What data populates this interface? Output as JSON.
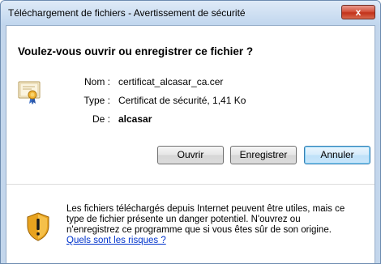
{
  "window": {
    "title": "Téléchargement de fichiers - Avertissement de sécurité",
    "close_label": "x"
  },
  "question": "Voulez-vous ouvrir ou enregistrer ce fichier ?",
  "file_info": {
    "name_label": "Nom :",
    "name_value": "certificat_alcasar_ca.cer",
    "type_label": "Type :",
    "type_value": "Certificat de sécurité, 1,41 Ko",
    "from_label": "De :",
    "from_value": "alcasar"
  },
  "buttons": {
    "open": "Ouvrir",
    "save": "Enregistrer",
    "cancel": "Annuler"
  },
  "warning": {
    "line1": "Les fichiers téléchargés depuis Internet peuvent être utiles, mais ce",
    "line2": "type de fichier présente un danger potentiel. N'ouvrez ou",
    "line3": "n'enregistrez ce programme que si vous êtes sûr de son origine.",
    "link": "Quels sont les risques ?"
  },
  "icons": {
    "file": "certificate-icon",
    "warning": "shield-warning-icon",
    "close": "close-icon"
  }
}
